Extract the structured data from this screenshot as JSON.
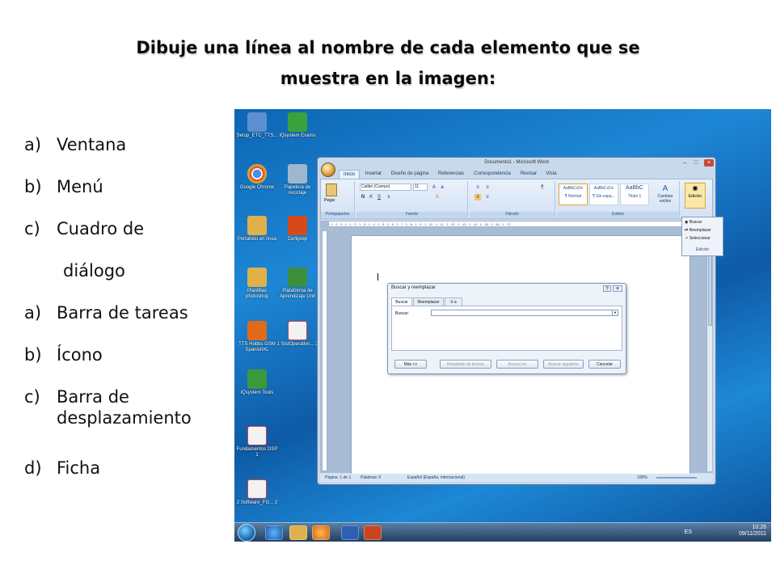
{
  "title": {
    "line1": "Dibuje una línea al nombre de cada elemento que se",
    "line2": "muestra en la imagen:"
  },
  "list_items": [
    {
      "marker": "a)",
      "text": "Ventana"
    },
    {
      "marker": "b)",
      "text": "Menú"
    },
    {
      "marker": "c)",
      "text": "Cuadro de"
    },
    {
      "marker": "",
      "text": "diálogo"
    },
    {
      "marker": "a)",
      "text": "Barra de tareas"
    },
    {
      "marker": "b)",
      "text": "Ícono"
    },
    {
      "marker": "c)",
      "text": "Barra de desplazamiento"
    },
    {
      "marker": "d)",
      "text": "Ficha"
    }
  ],
  "desktop_icons": [
    {
      "label": "Setup_ETC_TTS...",
      "color": "#5e8fd0"
    },
    {
      "label": "iQsystem Exams",
      "color": "#3aa23a"
    },
    {
      "label": "Google Chrome",
      "color": "#d9402b"
    },
    {
      "label": "Papelera de reciclaje",
      "color": "#9fb6cf"
    },
    {
      "label": "Portafolio en línea",
      "color": "#e0b14a"
    },
    {
      "label": "Certiprep",
      "color": "#d64a1a"
    },
    {
      "label": "Plantillas photoshop",
      "color": "#e0b14a"
    },
    {
      "label": "Plataforma de Aprendizaje Unit",
      "color": "#3d8f3d"
    },
    {
      "label": "TTS Hobbs GSM SpanishXL",
      "color": "#e06a1a"
    },
    {
      "label": "1 SistOperativo... 3",
      "color": "#f2f2f2"
    },
    {
      "label": "iQsystem Tools",
      "color": "#3a9a3a"
    },
    {
      "label": "Fundamentos DSP 1",
      "color": "#f2f2f2"
    },
    {
      "label": "2 Software_FG... 2",
      "color": "#f2f2f2"
    }
  ],
  "word": {
    "title": "Documento1 - Microsoft Word",
    "tabs": [
      "Inicio",
      "Insertar",
      "Diseño de página",
      "Referencias",
      "Correspondencia",
      "Revisar",
      "Vista"
    ],
    "ribbon": {
      "paste": "Pegar",
      "portapapeles": "Portapapeles",
      "font_name": "Calibri (Cuerpo)",
      "font_size": "11",
      "fuente": "Fuente",
      "parrafo": "Párrafo",
      "estilos": "Estilos",
      "styles": [
        {
          "sample": "AaBbCcDc",
          "name": "¶ Normal"
        },
        {
          "sample": "AaBbCcDc",
          "name": "¶ Sin espa..."
        },
        {
          "sample": "AaBbC",
          "name": "Título 1"
        }
      ],
      "cambiar_estilos": "Cambiar estilos",
      "edicion": "Edición"
    },
    "edicion_menu": [
      "Buscar",
      "Reemplazar",
      "Seleccionar",
      "Edición"
    ],
    "status": {
      "page": "Página: 1 de 1",
      "words": "Palabras: 0",
      "language": "Español (España, internacional)",
      "zoom": "100%"
    }
  },
  "dialog": {
    "title": "Buscar y reemplazar",
    "tabs": [
      "Buscar",
      "Reemplazar",
      "Ir a"
    ],
    "buscar_label": "Buscar:",
    "buttons": {
      "mas": "Más >>",
      "resaltado": "Resaltado de lectura",
      "buscar_en": "Buscar en",
      "buscar_siguiente": "Buscar siguiente",
      "cancelar": "Cancelar"
    }
  },
  "taskbar": {
    "lang": "ES",
    "time": "10:26",
    "date": "09/11/2011"
  }
}
